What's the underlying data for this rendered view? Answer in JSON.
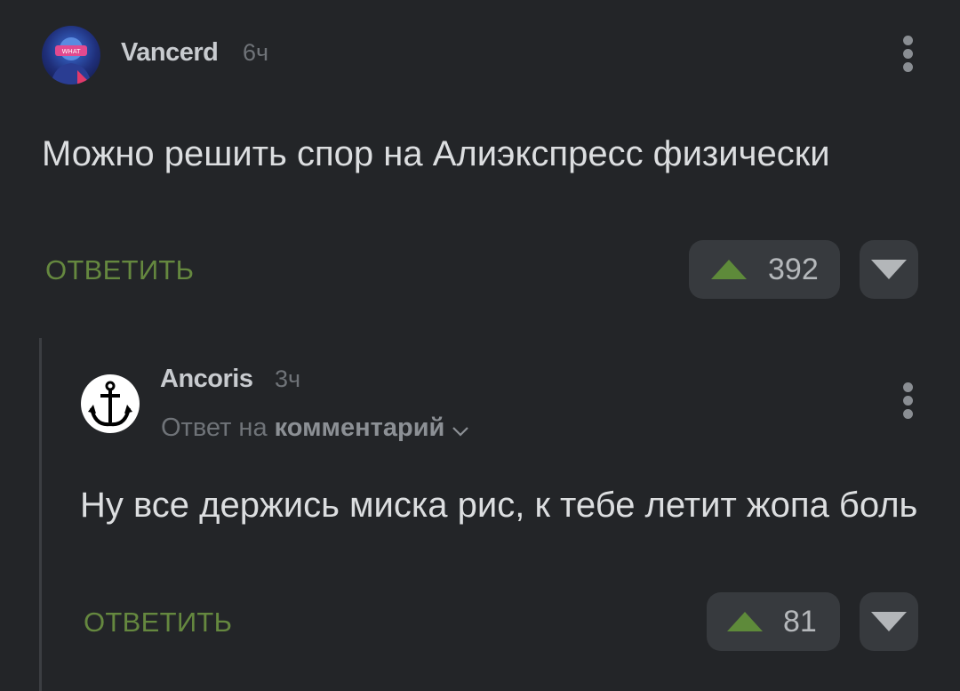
{
  "comments": [
    {
      "username": "Vancerd",
      "time": "6ч",
      "text": "Можно решить спор на Алиэкспресс физически",
      "reply_label": "ОТВЕТИТЬ",
      "rating": "392",
      "avatar_icon": "vr-headset-avatar"
    },
    {
      "username": "Ancoris",
      "time": "3ч",
      "reply_to_prefix": "Ответ на",
      "reply_to_target": "комментарий",
      "text": "Ну все держись миска рис, к тебе летит жопа боль",
      "reply_label": "ОТВЕТИТЬ",
      "rating": "81",
      "avatar_icon": "anchor-avatar"
    }
  ],
  "colors": {
    "background": "#232528",
    "accent_green": "#65883f",
    "upvote_arrow": "#5e8a3a",
    "button_bg": "#373a3e"
  }
}
